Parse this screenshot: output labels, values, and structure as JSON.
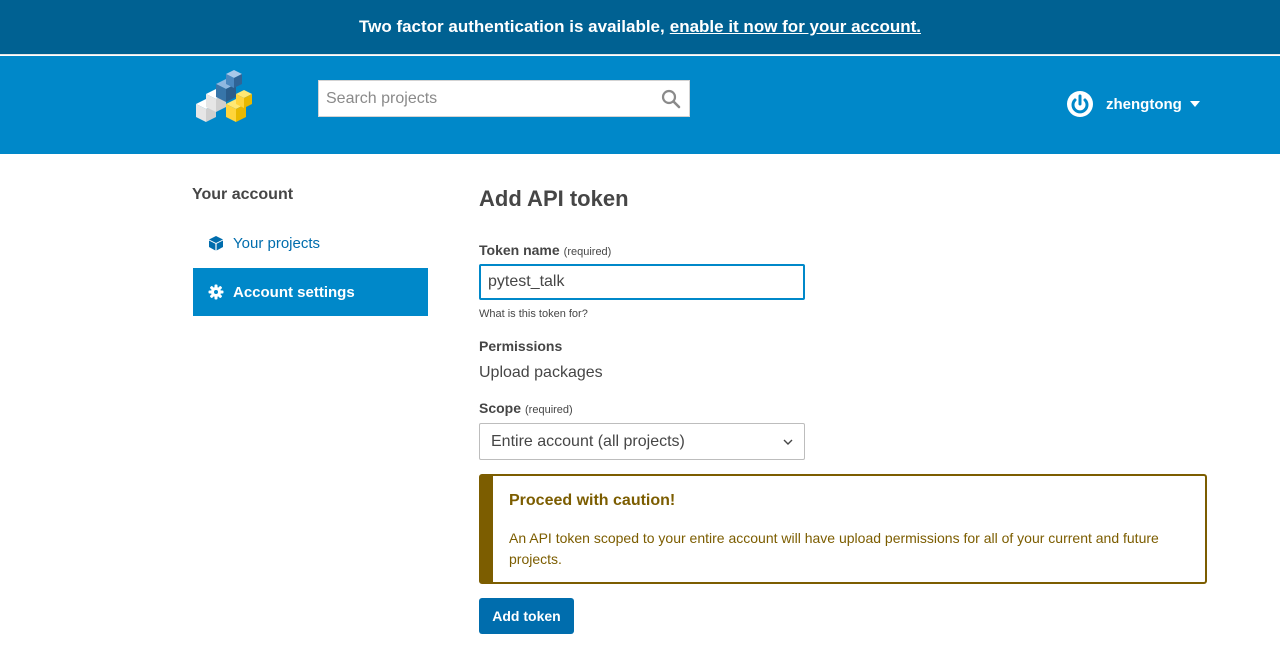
{
  "notice": {
    "text": "Two factor authentication is available,",
    "link": "enable it now for your account."
  },
  "header": {
    "logo_icon": "pypi-logo-icon",
    "search_placeholder": "Search projects",
    "search_icon": "search-icon",
    "username": "zhengtong",
    "avatar_icon": "user-avatar-icon"
  },
  "sidebar": {
    "title": "Your account",
    "items": [
      {
        "label": "Your projects",
        "icon": "cube-icon",
        "active": false
      },
      {
        "label": "Account settings",
        "icon": "gear-icon",
        "active": true
      }
    ]
  },
  "main": {
    "title": "Add API token",
    "token_name_label": "Token name",
    "token_name_required": "(required)",
    "token_name_value": "pytest_talk",
    "token_help": "What is this token for?",
    "permissions_label": "Permissions",
    "permissions_value": "Upload packages",
    "scope_label": "Scope",
    "scope_required": "(required)",
    "scope_value": "Entire account (all projects)",
    "callout_title": "Proceed with caution!",
    "callout_body": "An API token scoped to your entire account will have upload permissions for all of your current and future projects.",
    "submit_label": "Add token"
  },
  "colors": {
    "notice_bg": "#006192",
    "header_bg": "#0088c9",
    "primary_button": "#006dad",
    "caution": "#7c5d00"
  }
}
